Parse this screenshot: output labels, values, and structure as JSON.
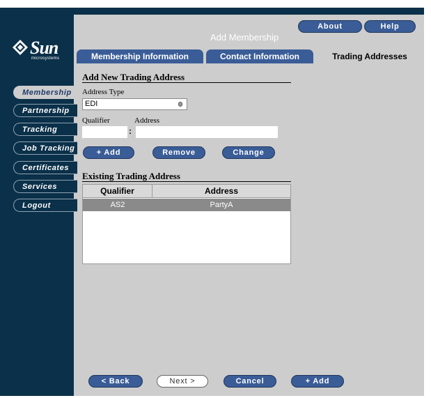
{
  "brand": {
    "name": "Sun",
    "sub": "microsystems"
  },
  "header": {
    "title": "Add Membership",
    "about_label": "About",
    "help_label": "Help"
  },
  "tabs": [
    {
      "label": "Membership Information"
    },
    {
      "label": "Contact Information"
    },
    {
      "label": "Trading Addresses"
    }
  ],
  "sidebar": {
    "items": [
      {
        "label": "Membership"
      },
      {
        "label": "Partnership"
      },
      {
        "label": "Tracking"
      },
      {
        "label": "Job Tracking"
      },
      {
        "label": "Certificates"
      },
      {
        "label": "Services"
      },
      {
        "label": "Logout"
      }
    ]
  },
  "form": {
    "section_title": "Add New Trading Address",
    "address_type_label": "Address Type",
    "address_type_value": "EDI",
    "qualifier_label": "Qualifier",
    "address_label": "Address",
    "qualifier_value": "",
    "address_value": "",
    "separator": ":",
    "add_label": "+ Add",
    "remove_label": "Remove",
    "change_label": "Change"
  },
  "existing": {
    "section_title": "Existing Trading Address",
    "columns": [
      "Qualifier",
      "Address"
    ],
    "rows": [
      {
        "qualifier": "AS2",
        "address": "PartyA"
      }
    ]
  },
  "footer": {
    "back_label": "< Back",
    "next_label": "Next >",
    "cancel_label": "Cancel",
    "add_label": "+ Add"
  },
  "colors": {
    "navy": "#0b3049",
    "panel_gray": "#cdcdcd",
    "button_blue": "#3a5d97",
    "selected_row": "#8a8a8a"
  }
}
